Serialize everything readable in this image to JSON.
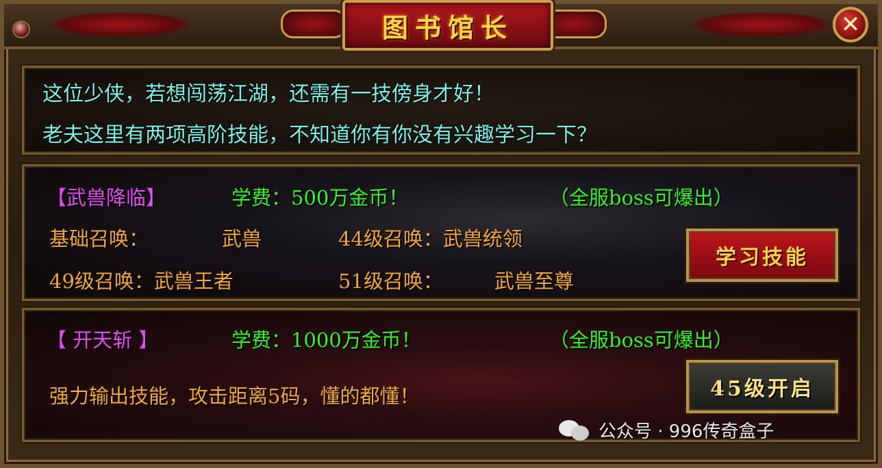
{
  "window": {
    "title": "图书馆长",
    "close_label": "✕"
  },
  "intro": {
    "line1": "这位少侠，若想闯荡江湖，还需有一技傍身才好！",
    "line2": "老夫这里有两项高阶技能，不知道你有你没有兴趣学习一下？"
  },
  "skill1": {
    "name": "【武兽降临】",
    "fee": "学费：500万金币！",
    "drop": "（全服boss可爆出）",
    "summon_base_label": "基础召唤：",
    "summon_base_value": "武兽",
    "summon_44": "44级召唤：武兽统领",
    "summon_49": "49级召唤：武兽王者",
    "summon_51_label": "51级召唤：",
    "summon_51_value": "武兽至尊",
    "button_label": "学习技能"
  },
  "skill2": {
    "name": "【 开天斩 】",
    "fee": "学费：1000万金币！",
    "drop": "（全服boss可爆出）",
    "description": "强力输出技能，攻击距离5码，懂的都懂！",
    "button_label": "45级开启"
  },
  "watermark": {
    "text": "公众号 · 996传奇盒子"
  },
  "colors": {
    "cyan_text": "#7ef0e6",
    "magenta_text": "#e04cf0",
    "green_text": "#36f02a",
    "orange_text": "#f3a53a",
    "title_gold": "#ffd24a"
  }
}
